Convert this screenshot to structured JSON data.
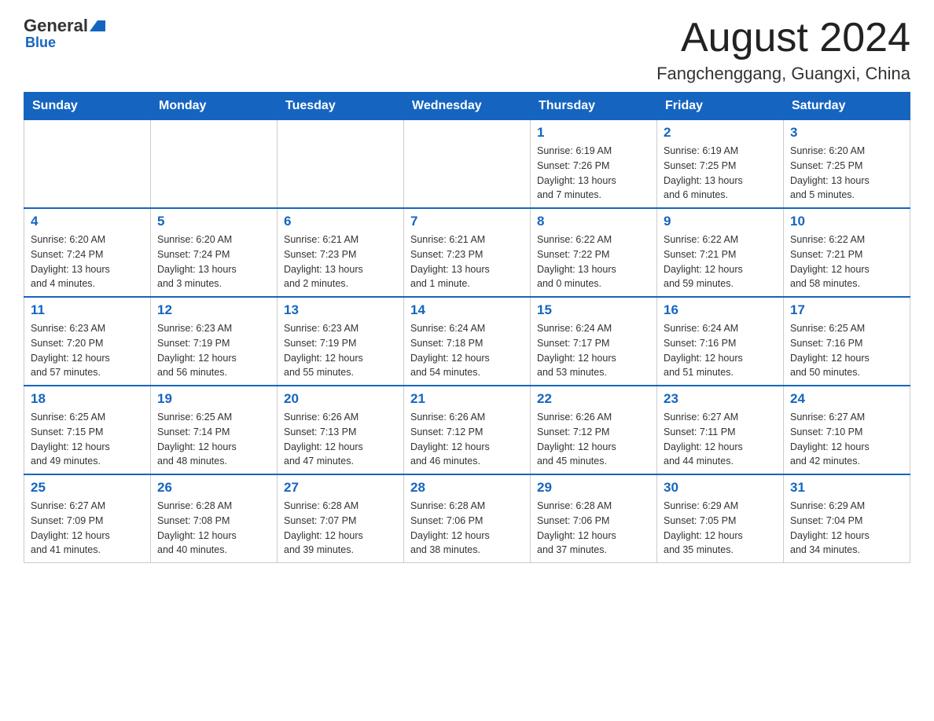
{
  "header": {
    "logo_general": "General",
    "logo_blue": "Blue",
    "main_title": "August 2024",
    "subtitle": "Fangchenggang, Guangxi, China"
  },
  "weekdays": [
    "Sunday",
    "Monday",
    "Tuesday",
    "Wednesday",
    "Thursday",
    "Friday",
    "Saturday"
  ],
  "weeks": [
    [
      {
        "day": "",
        "info": ""
      },
      {
        "day": "",
        "info": ""
      },
      {
        "day": "",
        "info": ""
      },
      {
        "day": "",
        "info": ""
      },
      {
        "day": "1",
        "info": "Sunrise: 6:19 AM\nSunset: 7:26 PM\nDaylight: 13 hours\nand 7 minutes."
      },
      {
        "day": "2",
        "info": "Sunrise: 6:19 AM\nSunset: 7:25 PM\nDaylight: 13 hours\nand 6 minutes."
      },
      {
        "day": "3",
        "info": "Sunrise: 6:20 AM\nSunset: 7:25 PM\nDaylight: 13 hours\nand 5 minutes."
      }
    ],
    [
      {
        "day": "4",
        "info": "Sunrise: 6:20 AM\nSunset: 7:24 PM\nDaylight: 13 hours\nand 4 minutes."
      },
      {
        "day": "5",
        "info": "Sunrise: 6:20 AM\nSunset: 7:24 PM\nDaylight: 13 hours\nand 3 minutes."
      },
      {
        "day": "6",
        "info": "Sunrise: 6:21 AM\nSunset: 7:23 PM\nDaylight: 13 hours\nand 2 minutes."
      },
      {
        "day": "7",
        "info": "Sunrise: 6:21 AM\nSunset: 7:23 PM\nDaylight: 13 hours\nand 1 minute."
      },
      {
        "day": "8",
        "info": "Sunrise: 6:22 AM\nSunset: 7:22 PM\nDaylight: 13 hours\nand 0 minutes."
      },
      {
        "day": "9",
        "info": "Sunrise: 6:22 AM\nSunset: 7:21 PM\nDaylight: 12 hours\nand 59 minutes."
      },
      {
        "day": "10",
        "info": "Sunrise: 6:22 AM\nSunset: 7:21 PM\nDaylight: 12 hours\nand 58 minutes."
      }
    ],
    [
      {
        "day": "11",
        "info": "Sunrise: 6:23 AM\nSunset: 7:20 PM\nDaylight: 12 hours\nand 57 minutes."
      },
      {
        "day": "12",
        "info": "Sunrise: 6:23 AM\nSunset: 7:19 PM\nDaylight: 12 hours\nand 56 minutes."
      },
      {
        "day": "13",
        "info": "Sunrise: 6:23 AM\nSunset: 7:19 PM\nDaylight: 12 hours\nand 55 minutes."
      },
      {
        "day": "14",
        "info": "Sunrise: 6:24 AM\nSunset: 7:18 PM\nDaylight: 12 hours\nand 54 minutes."
      },
      {
        "day": "15",
        "info": "Sunrise: 6:24 AM\nSunset: 7:17 PM\nDaylight: 12 hours\nand 53 minutes."
      },
      {
        "day": "16",
        "info": "Sunrise: 6:24 AM\nSunset: 7:16 PM\nDaylight: 12 hours\nand 51 minutes."
      },
      {
        "day": "17",
        "info": "Sunrise: 6:25 AM\nSunset: 7:16 PM\nDaylight: 12 hours\nand 50 minutes."
      }
    ],
    [
      {
        "day": "18",
        "info": "Sunrise: 6:25 AM\nSunset: 7:15 PM\nDaylight: 12 hours\nand 49 minutes."
      },
      {
        "day": "19",
        "info": "Sunrise: 6:25 AM\nSunset: 7:14 PM\nDaylight: 12 hours\nand 48 minutes."
      },
      {
        "day": "20",
        "info": "Sunrise: 6:26 AM\nSunset: 7:13 PM\nDaylight: 12 hours\nand 47 minutes."
      },
      {
        "day": "21",
        "info": "Sunrise: 6:26 AM\nSunset: 7:12 PM\nDaylight: 12 hours\nand 46 minutes."
      },
      {
        "day": "22",
        "info": "Sunrise: 6:26 AM\nSunset: 7:12 PM\nDaylight: 12 hours\nand 45 minutes."
      },
      {
        "day": "23",
        "info": "Sunrise: 6:27 AM\nSunset: 7:11 PM\nDaylight: 12 hours\nand 44 minutes."
      },
      {
        "day": "24",
        "info": "Sunrise: 6:27 AM\nSunset: 7:10 PM\nDaylight: 12 hours\nand 42 minutes."
      }
    ],
    [
      {
        "day": "25",
        "info": "Sunrise: 6:27 AM\nSunset: 7:09 PM\nDaylight: 12 hours\nand 41 minutes."
      },
      {
        "day": "26",
        "info": "Sunrise: 6:28 AM\nSunset: 7:08 PM\nDaylight: 12 hours\nand 40 minutes."
      },
      {
        "day": "27",
        "info": "Sunrise: 6:28 AM\nSunset: 7:07 PM\nDaylight: 12 hours\nand 39 minutes."
      },
      {
        "day": "28",
        "info": "Sunrise: 6:28 AM\nSunset: 7:06 PM\nDaylight: 12 hours\nand 38 minutes."
      },
      {
        "day": "29",
        "info": "Sunrise: 6:28 AM\nSunset: 7:06 PM\nDaylight: 12 hours\nand 37 minutes."
      },
      {
        "day": "30",
        "info": "Sunrise: 6:29 AM\nSunset: 7:05 PM\nDaylight: 12 hours\nand 35 minutes."
      },
      {
        "day": "31",
        "info": "Sunrise: 6:29 AM\nSunset: 7:04 PM\nDaylight: 12 hours\nand 34 minutes."
      }
    ]
  ]
}
